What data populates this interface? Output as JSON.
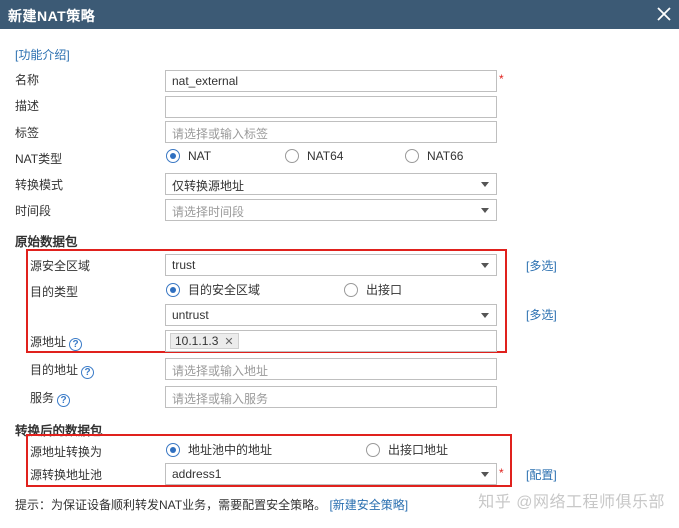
{
  "dialog": {
    "title": "新建NAT策略"
  },
  "intro_link": "[功能介绍]",
  "fields": {
    "name": {
      "label": "名称",
      "value": "nat_external"
    },
    "description": {
      "label": "描述",
      "value": ""
    },
    "tag": {
      "label": "标签",
      "placeholder": "请选择或输入标签"
    },
    "nat_type": {
      "label": "NAT类型",
      "options": [
        "NAT",
        "NAT64",
        "NAT66"
      ],
      "selected": "NAT"
    },
    "convert_mode": {
      "label": "转换模式",
      "value": "仅转换源地址"
    },
    "time_range": {
      "label": "时间段",
      "placeholder": "请选择时间段"
    }
  },
  "original_packet": {
    "section_title": "原始数据包",
    "src_zone": {
      "label": "源安全区域",
      "value": "trust",
      "multi_link": "[多选]"
    },
    "dest_type": {
      "label": "目的类型",
      "options": [
        "目的安全区域",
        "出接口"
      ],
      "selected": "目的安全区域"
    },
    "dest_zone": {
      "value": "untrust",
      "multi_link": "[多选]"
    },
    "src_address": {
      "label": "源地址",
      "tag": "10.1.1.3"
    },
    "dest_address": {
      "label": "目的地址",
      "placeholder": "请选择或输入地址"
    },
    "service": {
      "label": "服务",
      "placeholder": "请选择或输入服务"
    }
  },
  "translated_packet": {
    "section_title": "转换后的数据包",
    "src_translate_to": {
      "label": "源地址转换为",
      "options": [
        "地址池中的地址",
        "出接口地址"
      ],
      "selected": "地址池中的地址"
    },
    "src_pool": {
      "label": "源转换地址池",
      "value": "address1",
      "config_link": "[配置]"
    }
  },
  "footer": {
    "hint": "提示：为保证设备顺利转发NAT业务，需要配置安全策略。",
    "link": "[新建安全策略]"
  },
  "watermark": "知乎 @网络工程师俱乐部",
  "colors": {
    "titlebar": "#3c5a75",
    "highlight_border": "#e0211d",
    "link": "#2a6fb0",
    "radio_selected": "#2f6fc0"
  }
}
